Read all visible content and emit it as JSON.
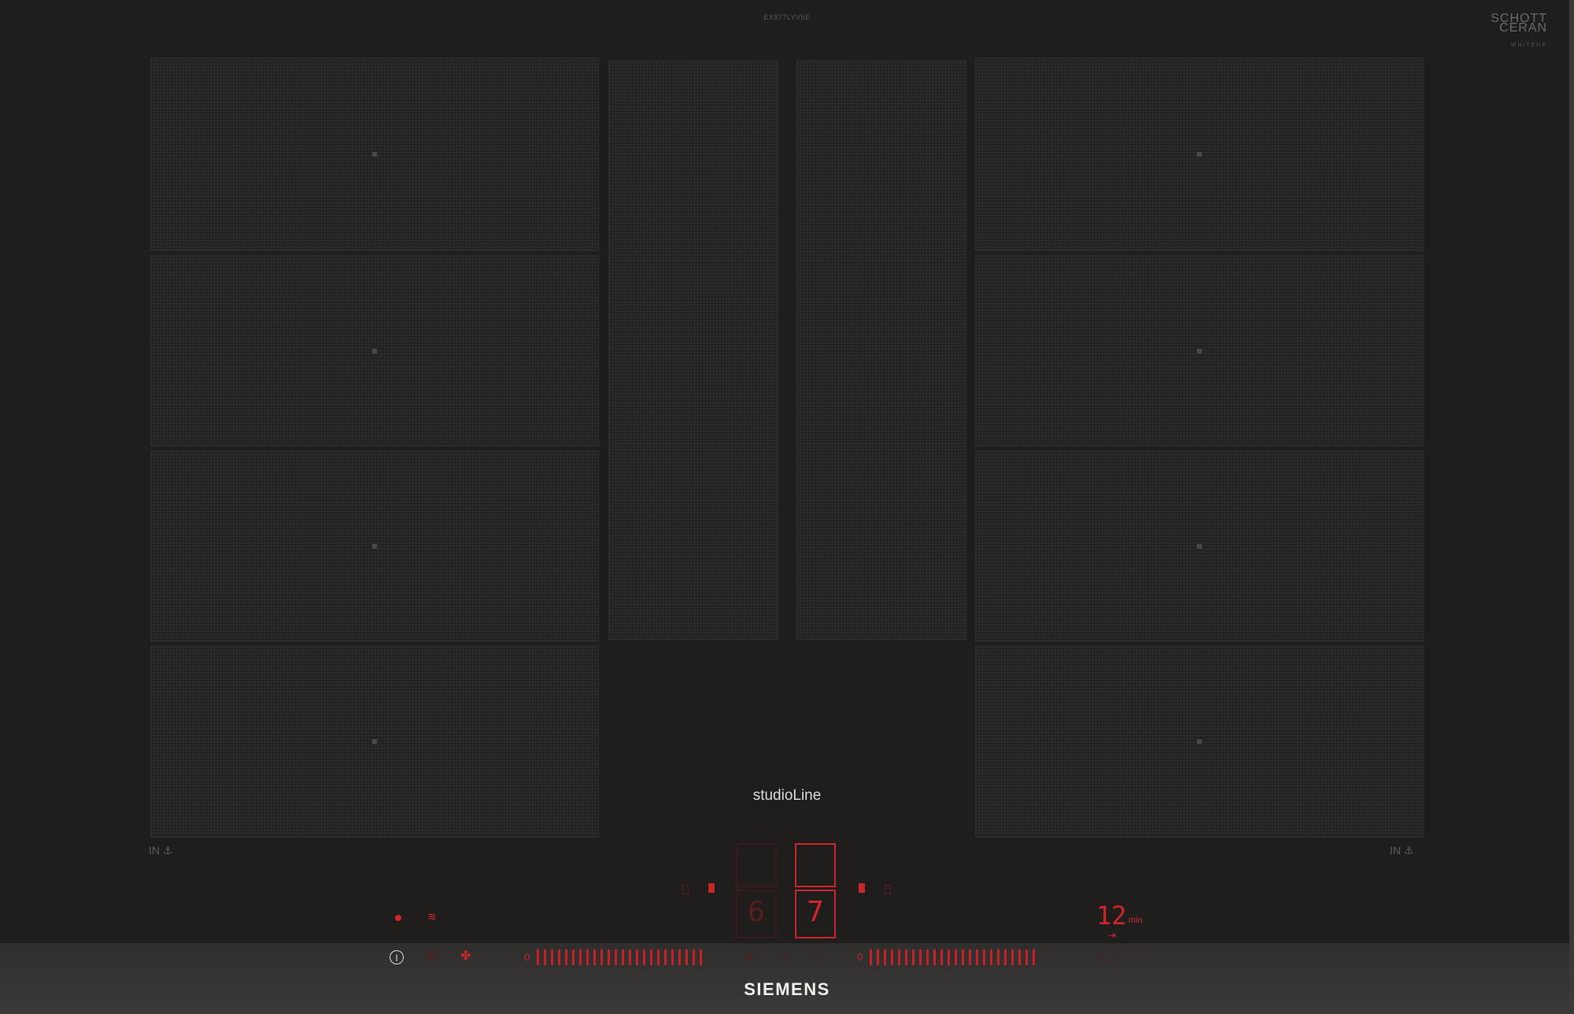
{
  "hob": {
    "model_number": "EX877LYV5E",
    "glass_brand": "SCHOTT",
    "glass_sub": "CERAN",
    "glass_sub2": "WHITEHE",
    "series_label": "studioLine",
    "brand": "SIEMENS",
    "left_zone_label": "IN",
    "right_zone_label": "IN"
  },
  "controls": {
    "left_display_digit": "6",
    "right_display_digit": "7",
    "timer_value": "12",
    "timer_unit": "min",
    "slider_left_start": "0",
    "slider_left_end": "0",
    "slider_right_start": "0",
    "slider_right_end": "0",
    "slider_left_level": 1.0,
    "slider_right_level": 1.0
  },
  "icons": {
    "power": "power-icon",
    "wifi": "wifi-icon",
    "fan": "fan-icon",
    "timer": "timer-icon"
  },
  "colors": {
    "glass": "#1f1e1d",
    "display_red": "#d3242a"
  }
}
